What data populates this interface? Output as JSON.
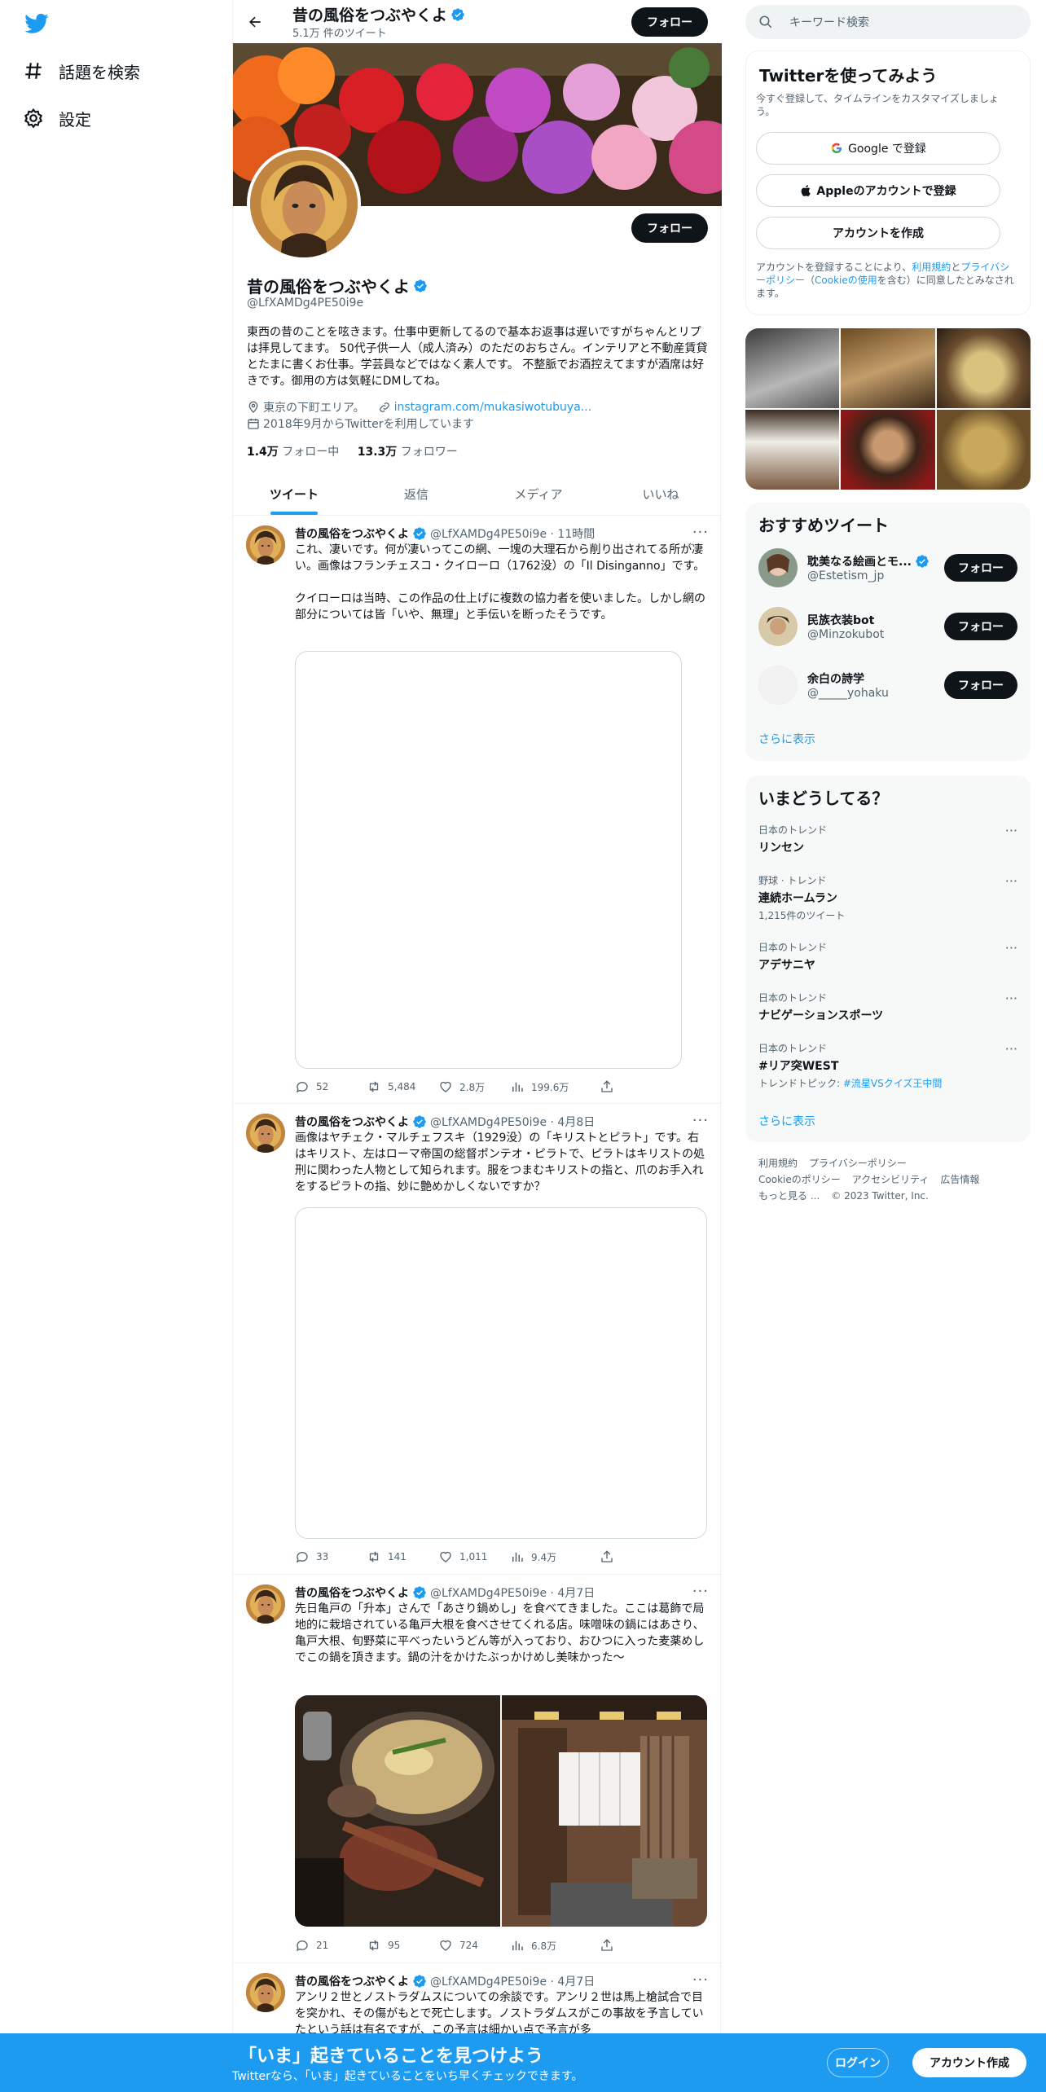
{
  "nav": {
    "explore_label": "話題を検索",
    "settings_label": "設定"
  },
  "profile": {
    "name": "昔の風俗をつぶやくよ",
    "tweet_count": "5.1万 件のツイート",
    "follow_label": "フォロー",
    "handle": "@LfXAMDg4PE50i9e",
    "bio": "東西の昔のことを呟きます。仕事中更新してるので基本お返事は遅いですがちゃんとリプは拝見してます。 50代子供一人（成人済み）のただのおちさん。インテリアと不動産賃貸とたまに書くお仕事。学芸員などではなく素人です。 不整脈でお酒控えてますが酒席は好きです。御用の方は気軽にDMしてね。",
    "location": "東京の下町エリア。",
    "link": "instagram.com/mukasiwotubuya...",
    "joined": "2018年9月からTwitterを利用しています",
    "following_count": "1.4万",
    "following_label": "フォロー中",
    "followers_count": "13.3万",
    "followers_label": "フォロワー"
  },
  "tabs": [
    "ツイート",
    "返信",
    "メディア",
    "いいね"
  ],
  "tweets": [
    {
      "name": "昔の風俗をつぶやくよ",
      "handle": "@LfXAMDg4PE50i9e · 11時間",
      "text": "これ、凄いです。何が凄いってこの網、一塊の大理石から削り出されてる所が凄い。画像はフランチェスコ・クイローロ（1762没）の「Il Disinganno」です。\n\nクイローロは当時、この作品の仕上げに複数の協力者を使いました。しかし網の部分については皆「いや、無理」と手伝いを断ったそうです。",
      "replies": "52",
      "retweets": "5,484",
      "likes": "2.8万",
      "views": "199.6万"
    },
    {
      "name": "昔の風俗をつぶやくよ",
      "handle": "@LfXAMDg4PE50i9e · 4月8日",
      "text": "画像はヤチェク・マルチェフスキ（1929没）の「キリストとピラト」です。右はキリスト、左はローマ帝国の総督ポンテオ・ピラトで、ピラトはキリストの処刑に関わった人物として知られます。服をつまむキリストの指と、爪のお手入れをするピラトの指、妙に艶めかしくないですか？",
      "replies": "33",
      "retweets": "141",
      "likes": "1,011",
      "views": "9.4万"
    },
    {
      "name": "昔の風俗をつぶやくよ",
      "handle": "@LfXAMDg4PE50i9e · 4月7日",
      "text": "先日亀戸の「升本」さんで「あさり鍋めし」を食べてきました。ここは葛飾で局地的に栽培されている亀戸大根を食べさせてくれる店。味噌味の鍋にはあさり、亀戸大根、旬野菜に平べったいうどん等が入っており、おひつに入った麦薬めしでこの鍋を頂きます。鍋の汁をかけたぶっかけめし美味かった～",
      "replies": "21",
      "retweets": "95",
      "likes": "724",
      "views": "6.8万"
    },
    {
      "name": "昔の風俗をつぶやくよ",
      "handle": "@LfXAMDg4PE50i9e · 4月7日",
      "text": "アンリ２世とノストラダムスについての余談です。アンリ２世は馬上槍試合で目を突かれ、その傷がもとで死亡します。ノストラダムスがこの事故を予言していたという話は有名ですが、この予言は細かい点で予言が多"
    }
  ],
  "right": {
    "search_placeholder": "キーワード検索",
    "signup_title": "Twitterを使ってみよう",
    "signup_sub": "今すぐ登録して、タイムラインをカスタマイズしましょう。",
    "google_btn": "Google で登録",
    "apple_btn": "Appleのアカウントで登録",
    "create_btn": "アカウントを作成",
    "terms_pre": "アカウントを登録することにより、",
    "terms_link1": "利用規約",
    "terms_mid1": "と",
    "terms_link2": "プライバシーポリシー",
    "terms_mid2": "（",
    "terms_link3": "Cookieの使用",
    "terms_post": "を含む）に同意したとみなされます。",
    "rec_title": "おすすめツイート",
    "recs": [
      {
        "name": "耽美なる絵画とモ...",
        "handle": "@Estetism_jp"
      },
      {
        "name": "民族衣装bot",
        "handle": "@Minzokubot"
      },
      {
        "name": "余白の詩学",
        "handle": "@_____yohaku"
      }
    ],
    "show_more": "さらに表示",
    "trends_title": "いまどうしてる？",
    "trends": [
      {
        "ctx": "日本のトレンド",
        "title": "リンセン",
        "sub": ""
      },
      {
        "ctx": "野球 · トレンド",
        "title": "連続ホームラン",
        "sub": "1,215件のツイート"
      },
      {
        "ctx": "日本のトレンド",
        "title": "アデサニヤ",
        "sub": ""
      },
      {
        "ctx": "日本のトレンド",
        "title": "ナビゲーションスポーツ",
        "sub": ""
      },
      {
        "ctx": "日本のトレンド",
        "title": "#リア突WEST",
        "sub": "トレンドトピック: ",
        "sub_link": "#流星VSクイズ王中間"
      }
    ],
    "footer": [
      "利用規約",
      "プライバシーポリシー",
      "Cookieのポリシー",
      "アクセシビリティ",
      "広告情報",
      "もっと見る ...",
      "© 2023 Twitter, Inc."
    ]
  },
  "bottom": {
    "title": "「いま」起きていることを見つけよう",
    "sub": "Twitterなら、「いま」起きていることをいち早くチェックできます。",
    "login": "ログイン",
    "signup": "アカウント作成"
  },
  "colors": {
    "accent": "#1d9bf0",
    "text": "#0f1419",
    "muted": "#536471"
  }
}
